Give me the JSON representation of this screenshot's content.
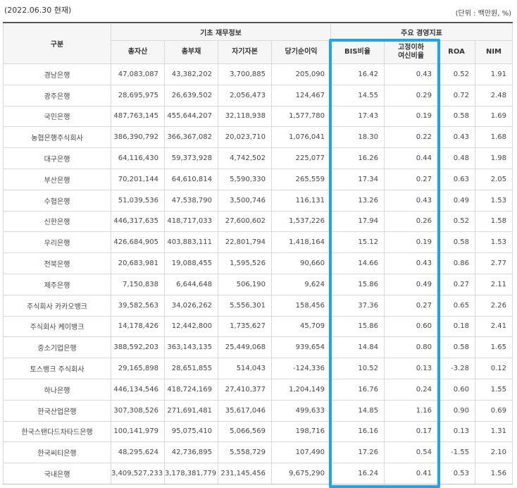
{
  "header": {
    "date": "(2022.06.30 현재)",
    "unit": "(단위 : 백만원, %)"
  },
  "columns": {
    "gubun": "구분",
    "group_basic": "기초 재무정보",
    "group_key": "주요 경영지표",
    "total_assets": "총자산",
    "total_liabilities": "총부채",
    "equity": "자기자본",
    "net_income": "당기순이익",
    "bis": "BIS비율",
    "npl_line1": "고정이하",
    "npl_line2": "여신비율",
    "roa": "ROA",
    "nim": "NIM"
  },
  "rows": [
    {
      "name": "경남은행",
      "assets": "47,083,087",
      "liabilities": "43,382,202",
      "equity": "3,700,885",
      "income": "205,090",
      "bis": "16.42",
      "npl": "0.43",
      "roa": "0.52",
      "nim": "1.91"
    },
    {
      "name": "광주은행",
      "assets": "28,695,975",
      "liabilities": "26,639,502",
      "equity": "2,056,473",
      "income": "124,467",
      "bis": "14.55",
      "npl": "0.29",
      "roa": "0.72",
      "nim": "2.48"
    },
    {
      "name": "국민은행",
      "assets": "487,763,145",
      "liabilities": "455,644,207",
      "equity": "32,118,938",
      "income": "1,577,780",
      "bis": "17.43",
      "npl": "0.19",
      "roa": "0.58",
      "nim": "1.69"
    },
    {
      "name": "농협은행주식회사",
      "assets": "386,390,792",
      "liabilities": "366,367,082",
      "equity": "20,023,710",
      "income": "1,076,041",
      "bis": "18.30",
      "npl": "0.22",
      "roa": "0.43",
      "nim": "1.68"
    },
    {
      "name": "대구은행",
      "assets": "64,116,430",
      "liabilities": "59,373,928",
      "equity": "4,742,502",
      "income": "225,077",
      "bis": "16.26",
      "npl": "0.44",
      "roa": "0.48",
      "nim": "1.98"
    },
    {
      "name": "부산은행",
      "assets": "70,201,144",
      "liabilities": "64,610,814",
      "equity": "5,590,330",
      "income": "265,559",
      "bis": "17.34",
      "npl": "0.27",
      "roa": "0.63",
      "nim": "2.05"
    },
    {
      "name": "수협은행",
      "assets": "51,039,536",
      "liabilities": "47,538,790",
      "equity": "3,500,746",
      "income": "116,131",
      "bis": "13.26",
      "npl": "0.43",
      "roa": "0.49",
      "nim": "1.53"
    },
    {
      "name": "신한은행",
      "assets": "446,317,635",
      "liabilities": "418,717,033",
      "equity": "27,600,602",
      "income": "1,537,226",
      "bis": "17.94",
      "npl": "0.26",
      "roa": "0.52",
      "nim": "1.58"
    },
    {
      "name": "우리은행",
      "assets": "426,684,905",
      "liabilities": "403,883,111",
      "equity": "22,801,794",
      "income": "1,418,164",
      "bis": "15.12",
      "npl": "0.19",
      "roa": "0.58",
      "nim": "1.53"
    },
    {
      "name": "전북은행",
      "assets": "20,683,981",
      "liabilities": "19,088,455",
      "equity": "1,595,526",
      "income": "90,660",
      "bis": "14.66",
      "npl": "0.43",
      "roa": "0.86",
      "nim": "2.77"
    },
    {
      "name": "제주은행",
      "assets": "7,150,838",
      "liabilities": "6,644,648",
      "equity": "506,190",
      "income": "9,624",
      "bis": "15.86",
      "npl": "0.49",
      "roa": "0.27",
      "nim": "2.11"
    },
    {
      "name": "주식회사 카카오뱅크",
      "assets": "39,582,563",
      "liabilities": "34,026,262",
      "equity": "5,556,301",
      "income": "158,456",
      "bis": "37.36",
      "npl": "0.27",
      "roa": "0.65",
      "nim": "2.26"
    },
    {
      "name": "주식회사 케이뱅크",
      "assets": "14,178,426",
      "liabilities": "12,442,800",
      "equity": "1,735,627",
      "income": "45,709",
      "bis": "15.86",
      "npl": "0.60",
      "roa": "0.18",
      "nim": "2.41"
    },
    {
      "name": "중소기업은행",
      "assets": "388,592,203",
      "liabilities": "363,143,135",
      "equity": "25,449,068",
      "income": "939,654",
      "bis": "14.84",
      "npl": "0.80",
      "roa": "0.58",
      "nim": "1.65"
    },
    {
      "name": "토스뱅크 주식회사",
      "assets": "29,165,898",
      "liabilities": "28,651,855",
      "equity": "514,043",
      "income": "-124,336",
      "bis": "10.52",
      "npl": "0.13",
      "roa": "-3.28",
      "nim": "0.12"
    },
    {
      "name": "하나은행",
      "assets": "446,134,546",
      "liabilities": "418,724,169",
      "equity": "27,410,377",
      "income": "1,204,149",
      "bis": "16.76",
      "npl": "0.24",
      "roa": "0.60",
      "nim": "1.55"
    },
    {
      "name": "한국산업은행",
      "assets": "307,308,526",
      "liabilities": "271,691,481",
      "equity": "35,617,046",
      "income": "499,633",
      "bis": "14.85",
      "npl": "1.16",
      "roa": "0.90",
      "nim": "0.69"
    },
    {
      "name": "한국스탠다드차타드은행",
      "assets": "100,141,979",
      "liabilities": "95,075,410",
      "equity": "5,066,569",
      "income": "198,716",
      "bis": "16.16",
      "npl": "0.17",
      "roa": "0.13",
      "nim": "1.31"
    },
    {
      "name": "한국씨티은행",
      "assets": "48,295,624",
      "liabilities": "42,736,895",
      "equity": "5,558,729",
      "income": "107,490",
      "bis": "17.26",
      "npl": "0.54",
      "roa": "-1.55",
      "nim": "2.10"
    },
    {
      "name": "국내은행",
      "assets": "3,409,527,233",
      "liabilities": "3,178,381,779",
      "equity": "231,145,456",
      "income": "9,675,290",
      "bis": "16.24",
      "npl": "0.41",
      "roa": "0.53",
      "nim": "1.56"
    }
  ],
  "highlight_color": "#1aa5ee"
}
